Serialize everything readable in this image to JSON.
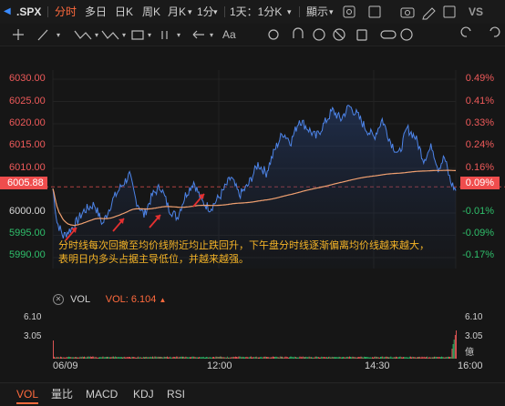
{
  "toolbar": {
    "symbol": ".SPX",
    "periods": [
      "分时",
      "多日",
      "日K",
      "周K",
      "月K",
      "1分"
    ],
    "active_period": "分时",
    "multi": "1天：1分K",
    "display": "顯示",
    "vs": "VS"
  },
  "draw_tools": {
    "text_tool": "Aa"
  },
  "price_axis": {
    "labels": [
      "6030.00",
      "6025.00",
      "6020.00",
      "6015.00",
      "6010.00",
      "6005.88",
      "6000.00",
      "5995.00",
      "5990.00"
    ],
    "pct_labels": [
      "0.49%",
      "0.41%",
      "0.33%",
      "0.24%",
      "0.16%",
      "0.09%",
      "-0.01%",
      "-0.09%",
      "-0.17%"
    ],
    "base_price": "6005.88",
    "base_pct": "0.09%"
  },
  "annotation": {
    "line1": "分时线每次回撤至均价线附近均止跌回升，下午盘分时线逐渐偏离均价线越来越大，",
    "line2": "表明日内多头占据主导低位，并越来越强。"
  },
  "volume": {
    "indicator": "VOL",
    "label": "VOL: 6.104",
    "ticks_left": [
      "6.10",
      "3.05"
    ],
    "ticks_right": [
      "6.10",
      "3.05",
      "億"
    ]
  },
  "time_axis": [
    "06/09",
    "12:00",
    "14:30",
    "16:00"
  ],
  "bottom_tabs": [
    "VOL",
    "量比",
    "MACD",
    "KDJ",
    "RSI"
  ],
  "active_tab": "VOL",
  "colors": {
    "price_line": "#4d84e8",
    "avg_line": "#f0a070",
    "up": "#ef5a5a",
    "down": "#2fbf6b",
    "accent": "#ff6a3d",
    "annotation": "#f5b427"
  }
}
